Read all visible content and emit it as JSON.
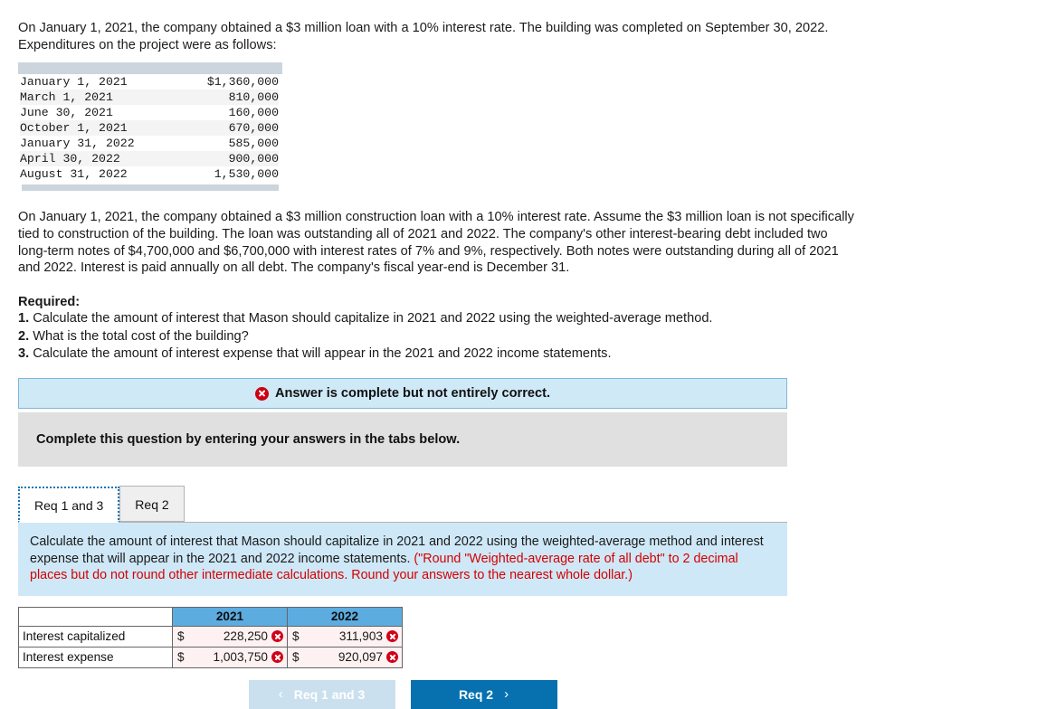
{
  "intro": {
    "paragraph": "On January 1, 2021, the company obtained a $3 million loan with a 10% interest rate. The building was completed on September 30, 2022. Expenditures on the project were as follows:"
  },
  "expenditures": {
    "rows": [
      {
        "date": "January 1, 2021",
        "amount": "$1,360,000"
      },
      {
        "date": "March 1, 2021",
        "amount": "810,000"
      },
      {
        "date": "June 30, 2021",
        "amount": "160,000"
      },
      {
        "date": "October 1, 2021",
        "amount": "670,000"
      },
      {
        "date": "January 31, 2022",
        "amount": "585,000"
      },
      {
        "date": "April 30, 2022",
        "amount": "900,000"
      },
      {
        "date": "August 31, 2022",
        "amount": "1,530,000"
      }
    ]
  },
  "paragraph2": "On January 1, 2021, the company obtained a $3 million construction loan with a 10% interest rate. Assume the $3 million loan is not specifically tied to construction of the building. The loan was outstanding all of 2021 and 2022. The company's other interest-bearing debt included two long-term notes of $4,700,000 and $6,700,000 with interest rates of 7% and 9%, respectively. Both notes were outstanding during all of 2021 and 2022. Interest is paid annually on all debt. The company's fiscal year-end is December 31.",
  "required": {
    "title": "Required:",
    "items": [
      {
        "num": "1.",
        "text": "Calculate the amount of interest that Mason should capitalize in 2021 and 2022 using the weighted-average method."
      },
      {
        "num": "2.",
        "text": "What is the total cost of the building?"
      },
      {
        "num": "3.",
        "text": "Calculate the amount of interest expense that will appear in the 2021 and 2022 income statements."
      }
    ]
  },
  "banner": {
    "text": "Answer is complete but not entirely correct.",
    "icon": "error-x-icon",
    "background_color": "#cfe9f7",
    "border_color": "#7fb8d8",
    "icon_color": "#cc0011"
  },
  "grey_panel": {
    "text": "Complete this question by entering your answers in the tabs below."
  },
  "tabs": [
    {
      "label": "Req 1 and 3",
      "active": true
    },
    {
      "label": "Req 2",
      "active": false
    }
  ],
  "instruction": {
    "text_black": "Calculate the amount of interest that Mason should capitalize in 2021 and 2022 using the weighted-average method and interest expense that will appear in the 2021 and 2022 income statements. ",
    "text_red": "(\"Round \"Weighted-average rate of all debt\" to 2 decimal places but do not round other intermediate calculations. Round your answers to the nearest whole dollar.)",
    "background_color": "#cfe8f7",
    "red_color": "#d40000"
  },
  "answer_table": {
    "header_color": "#5cace0",
    "cell_color": "#fdf1f1",
    "columns": [
      "",
      "2021",
      "2022"
    ],
    "rows": [
      {
        "label": "Interest capitalized",
        "y2021": {
          "currency": "$",
          "value": "228,250",
          "status": "incorrect"
        },
        "y2022": {
          "currency": "$",
          "value": "311,903",
          "status": "incorrect"
        }
      },
      {
        "label": "Interest expense",
        "y2021": {
          "currency": "$",
          "value": "1,003,750",
          "status": "incorrect"
        },
        "y2022": {
          "currency": "$",
          "value": "920,097",
          "status": "incorrect"
        }
      }
    ]
  },
  "nav": {
    "prev_label": "Req 1 and 3",
    "next_label": "Req 2",
    "prev_chevron": "‹",
    "next_chevron": "›",
    "prev_color": "#cbe0ee",
    "next_color": "#0671ae"
  }
}
